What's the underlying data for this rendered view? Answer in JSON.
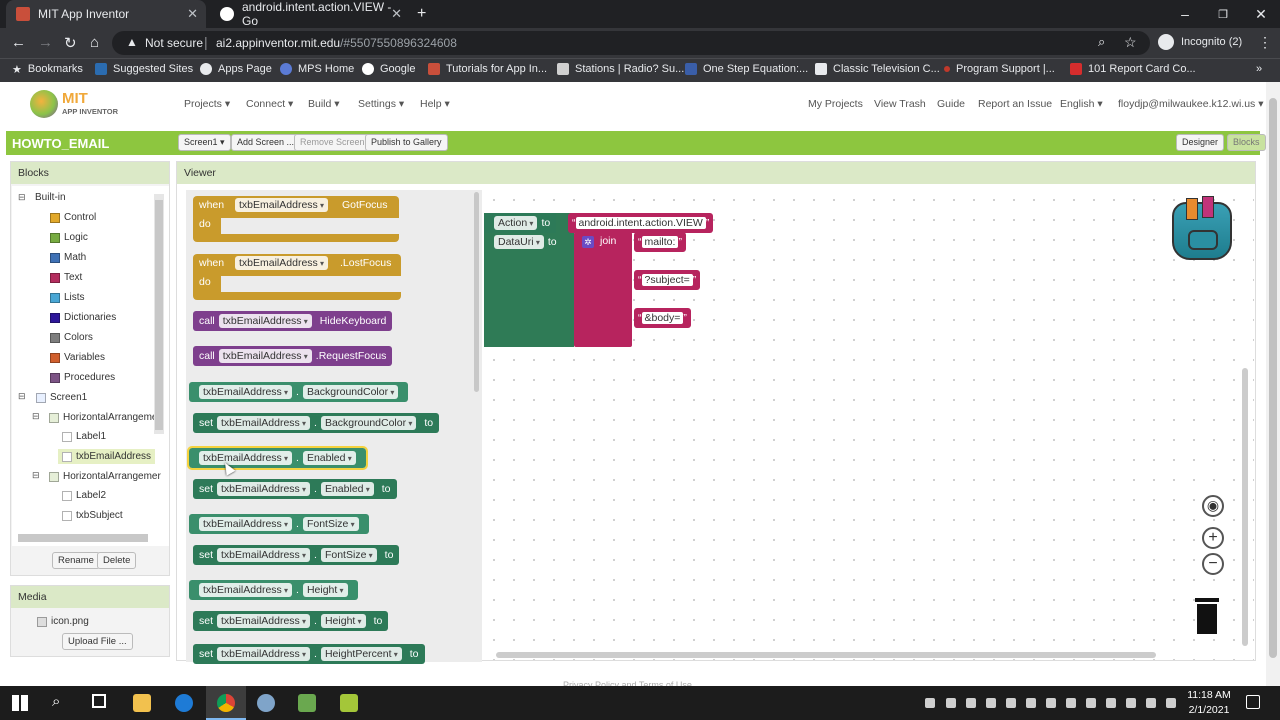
{
  "browser": {
    "tabs": [
      {
        "title": "MIT App Inventor",
        "active": true
      },
      {
        "title": "android.intent.action.VIEW - Go",
        "active": false
      }
    ],
    "new_tab": "+",
    "window_controls": {
      "minimize": "–",
      "maximize": "❐",
      "close": "✕"
    },
    "security": "Not secure",
    "url_host": "ai2.appinventor.mit.edu",
    "url_path": "/#5507550896324608",
    "profile": "Incognito (2)",
    "bookmarks": [
      "Bookmarks",
      "Suggested Sites",
      "Apps Page",
      "MPS Home",
      "Google",
      "Tutorials for App In...",
      "Stations | Radio? Su...",
      "One Step Equation:...",
      "Classic Television C...",
      "Program Support |...",
      "101 Report Card Co..."
    ]
  },
  "app": {
    "logo_top": "MIT",
    "logo_bottom": "APP INVENTOR",
    "menus": [
      "Projects ▾",
      "Connect ▾",
      "Build ▾",
      "Settings ▾",
      "Help ▾"
    ],
    "right_menus": [
      "My Projects",
      "View Trash",
      "Guide",
      "Report an Issue",
      "English ▾",
      "floydjp@milwaukee.k12.wi.us ▾"
    ],
    "project_name": "HOWTO_EMAIL",
    "project_buttons": [
      "Screen1 ▾",
      "Add Screen ...",
      "Remove Screen",
      "Publish to Gallery"
    ],
    "mode_buttons": [
      "Designer",
      "Blocks"
    ],
    "footer": "Privacy Policy and Terms of Use"
  },
  "blocks_panel": {
    "title": "Blocks",
    "builtin_label": "Built-in",
    "builtin": [
      {
        "label": "Control",
        "color": "#e1a82a"
      },
      {
        "label": "Logic",
        "color": "#77ab41"
      },
      {
        "label": "Math",
        "color": "#3f71b5"
      },
      {
        "label": "Text",
        "color": "#b32d5e"
      },
      {
        "label": "Lists",
        "color": "#49a6d4"
      },
      {
        "label": "Dictionaries",
        "color": "#2d1799"
      },
      {
        "label": "Colors",
        "color": "#7d7d7d"
      },
      {
        "label": "Variables",
        "color": "#d05f2d"
      },
      {
        "label": "Procedures",
        "color": "#7c5385"
      }
    ],
    "screen": "Screen1",
    "components": [
      "HorizontalArrangemer",
      "Label1",
      "txbEmailAddress",
      "HorizontalArrangemer",
      "Label2",
      "txbSubject"
    ],
    "rename": "Rename",
    "delete": "Delete"
  },
  "media_panel": {
    "title": "Media",
    "file": "icon.png",
    "upload": "Upload File ..."
  },
  "viewer": {
    "title": "Viewer",
    "flyout": {
      "component": "txbEmailAddress",
      "when": "when",
      "do": "do",
      "call": "call",
      "set": "set",
      "to": "to",
      "gotfocus": "GotFocus",
      "lostfocus": ".LostFocus",
      "hidekeyboard": "HideKeyboard",
      "requestfocus": ".RequestFocus",
      "properties": [
        "BackgroundColor",
        "Enabled",
        "FontSize",
        "Height",
        "HeightPercent"
      ]
    },
    "workspace": {
      "action_label": "Action",
      "to": "to",
      "action_value": "android.intent.action.VIEW",
      "datauri_label": "DataUri",
      "join": "join",
      "parts": [
        "mailto:",
        "?subject=",
        "&body="
      ]
    }
  },
  "taskbar": {
    "time": "11:18 AM",
    "date": "2/1/2021"
  }
}
